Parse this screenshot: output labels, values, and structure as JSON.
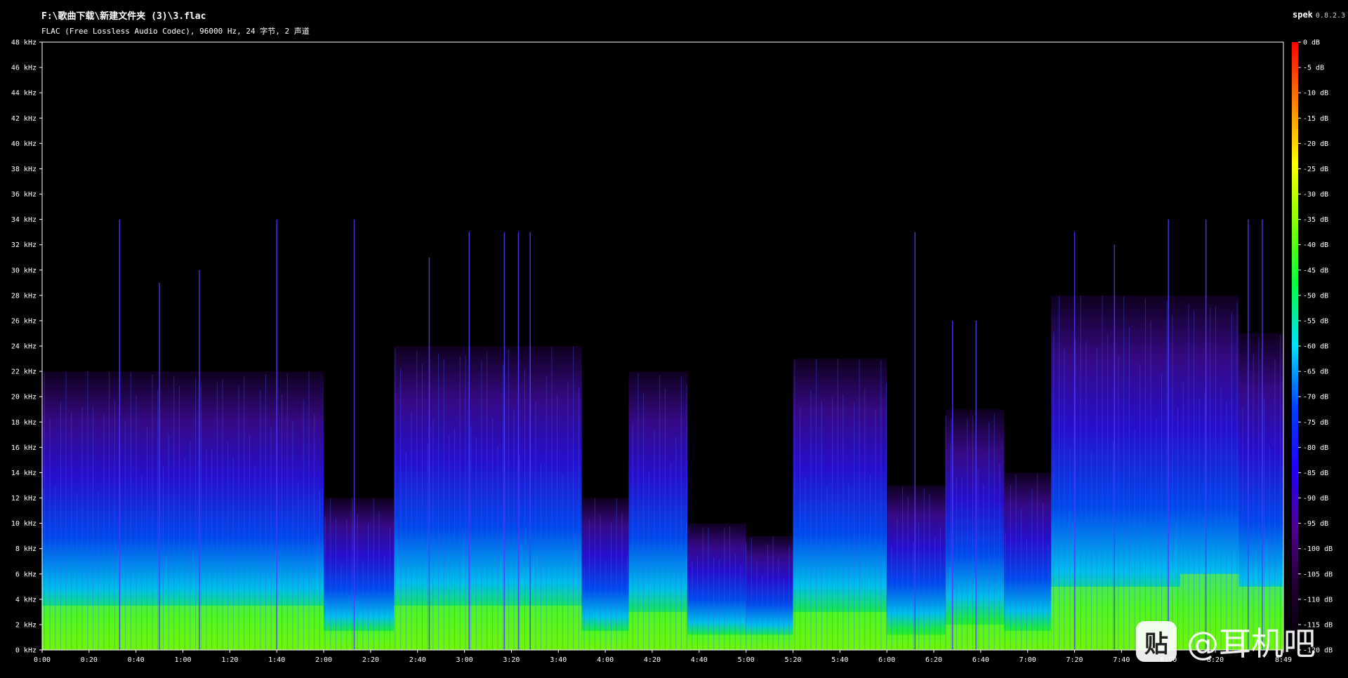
{
  "title": "F:\\歌曲下载\\新建文件夹 (3)\\3.flac",
  "subtitle": "FLAC (Free Lossless Audio Codec), 96000 Hz, 24 字节, 2 声道",
  "brand": {
    "name": "spek",
    "version": "0.8.2.3"
  },
  "watermark": {
    "badge": "贴",
    "text": "@耳机吧"
  },
  "chart_data": {
    "type": "heatmap",
    "title": "F:\\歌曲下载\\新建文件夹 (3)\\3.flac",
    "xlabel": "",
    "ylabel": "",
    "duration_s": 529,
    "x_ticks": [
      "0:00",
      "0:20",
      "0:40",
      "1:00",
      "1:20",
      "1:40",
      "2:00",
      "2:20",
      "2:40",
      "3:00",
      "3:20",
      "3:40",
      "4:00",
      "4:20",
      "4:40",
      "5:00",
      "5:20",
      "5:40",
      "6:00",
      "6:20",
      "6:40",
      "7:00",
      "7:20",
      "7:40",
      "8:00",
      "8:20",
      "8:49"
    ],
    "y_ticks": [
      "0 kHz",
      "2 kHz",
      "4 kHz",
      "6 kHz",
      "8 kHz",
      "10 kHz",
      "12 kHz",
      "14 kHz",
      "16 kHz",
      "18 kHz",
      "20 kHz",
      "22 kHz",
      "24 kHz",
      "26 kHz",
      "28 kHz",
      "30 kHz",
      "32 kHz",
      "34 kHz",
      "36 kHz",
      "38 kHz",
      "40 kHz",
      "42 kHz",
      "44 kHz",
      "46 kHz",
      "48 kHz"
    ],
    "ylim_khz": [
      0,
      48
    ],
    "colorbar_ticks": [
      "0 dB",
      "-5 dB",
      "-10 dB",
      "-15 dB",
      "-20 dB",
      "-25 dB",
      "-30 dB",
      "-35 dB",
      "-40 dB",
      "-45 dB",
      "-50 dB",
      "-55 dB",
      "-60 dB",
      "-65 dB",
      "-70 dB",
      "-75 dB",
      "-80 dB",
      "-85 dB",
      "-90 dB",
      "-95 dB",
      "-100 dB",
      "-105 dB",
      "-110 dB",
      "-115 dB",
      "-120 dB"
    ],
    "colorbar_range_db": [
      0,
      -120
    ],
    "colormap": [
      "#ff0000",
      "#ff8000",
      "#ffff00",
      "#80ff00",
      "#00ff40",
      "#00e0ff",
      "#0040ff",
      "#2000ff",
      "#500090",
      "#200030",
      "#000000"
    ],
    "segments": [
      {
        "start_s": 0,
        "end_s": 120,
        "top_khz": 22,
        "bright_khz": 3.5
      },
      {
        "start_s": 120,
        "end_s": 150,
        "top_khz": 12,
        "bright_khz": 1.5
      },
      {
        "start_s": 150,
        "end_s": 230,
        "top_khz": 24,
        "bright_khz": 3.5
      },
      {
        "start_s": 230,
        "end_s": 250,
        "top_khz": 12,
        "bright_khz": 1.5
      },
      {
        "start_s": 250,
        "end_s": 275,
        "top_khz": 22,
        "bright_khz": 3
      },
      {
        "start_s": 275,
        "end_s": 300,
        "top_khz": 10,
        "bright_khz": 1.2
      },
      {
        "start_s": 300,
        "end_s": 320,
        "top_khz": 9,
        "bright_khz": 1.2
      },
      {
        "start_s": 320,
        "end_s": 360,
        "top_khz": 23,
        "bright_khz": 3
      },
      {
        "start_s": 360,
        "end_s": 385,
        "top_khz": 13,
        "bright_khz": 1.2
      },
      {
        "start_s": 385,
        "end_s": 410,
        "top_khz": 19,
        "bright_khz": 2
      },
      {
        "start_s": 410,
        "end_s": 430,
        "top_khz": 14,
        "bright_khz": 1.5
      },
      {
        "start_s": 430,
        "end_s": 485,
        "top_khz": 28,
        "bright_khz": 5
      },
      {
        "start_s": 485,
        "end_s": 510,
        "top_khz": 28,
        "bright_khz": 6
      },
      {
        "start_s": 510,
        "end_s": 529,
        "top_khz": 25,
        "bright_khz": 5
      }
    ],
    "transient_peaks": [
      {
        "t_s": 33,
        "peak_khz": 34
      },
      {
        "t_s": 50,
        "peak_khz": 29
      },
      {
        "t_s": 67,
        "peak_khz": 30
      },
      {
        "t_s": 100,
        "peak_khz": 34
      },
      {
        "t_s": 133,
        "peak_khz": 34
      },
      {
        "t_s": 165,
        "peak_khz": 31
      },
      {
        "t_s": 182,
        "peak_khz": 33
      },
      {
        "t_s": 197,
        "peak_khz": 33
      },
      {
        "t_s": 203,
        "peak_khz": 33
      },
      {
        "t_s": 208,
        "peak_khz": 33
      },
      {
        "t_s": 372,
        "peak_khz": 33
      },
      {
        "t_s": 388,
        "peak_khz": 26
      },
      {
        "t_s": 398,
        "peak_khz": 26
      },
      {
        "t_s": 440,
        "peak_khz": 33
      },
      {
        "t_s": 457,
        "peak_khz": 32
      },
      {
        "t_s": 480,
        "peak_khz": 34
      },
      {
        "t_s": 496,
        "peak_khz": 34
      },
      {
        "t_s": 514,
        "peak_khz": 34
      },
      {
        "t_s": 520,
        "peak_khz": 34
      }
    ]
  }
}
